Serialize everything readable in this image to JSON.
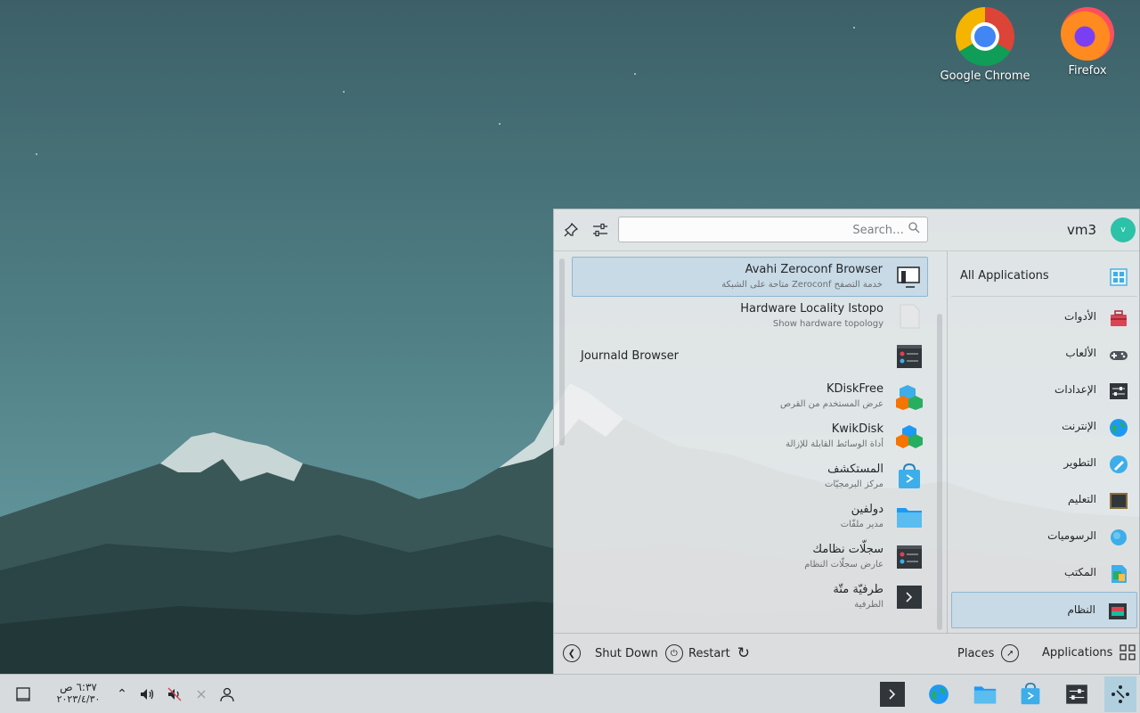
{
  "desktop": {
    "icons": [
      {
        "label": "Google Chrome",
        "icon": "chrome-icon"
      },
      {
        "label": "Firefox",
        "icon": "firefox-icon"
      }
    ]
  },
  "launcher": {
    "search_placeholder": "Search…",
    "user_name": "vm3",
    "avatar_letter": "v",
    "apps": [
      {
        "name": "Avahi Zeroconf Browser",
        "desc": "خدمة التصفح Zeroconf متاحة على الشبكة",
        "icon": "monitor-network-icon",
        "selected": true
      },
      {
        "name": "Hardware Locality lstopo",
        "desc": "Show hardware topology",
        "icon": "blank-file-icon"
      },
      {
        "name": "Journald Browser",
        "desc": "",
        "icon": "system-log-icon"
      },
      {
        "name": "KDiskFree",
        "desc": "عرض المستخدم من القرص",
        "icon": "kdiskfree-icon"
      },
      {
        "name": "KwikDisk",
        "desc": "أداة الوسائط القابلة للإزالة",
        "icon": "kwikdisk-icon"
      },
      {
        "name": "المستكشف",
        "desc": "مركز البرمجيّات",
        "icon": "discover-icon"
      },
      {
        "name": "دولفين",
        "desc": "مدير ملفّات",
        "icon": "folder-icon"
      },
      {
        "name": "سجلّات نظامك",
        "desc": "عارض سجلّات النظام",
        "icon": "system-log-icon"
      },
      {
        "name": "طرفيّة متّة",
        "desc": "الطرفية",
        "icon": "terminal-icon"
      }
    ],
    "categories": [
      {
        "label": "All Applications",
        "icon": "grid-apps-icon"
      },
      {
        "label": "الأدوات",
        "icon": "toolbox-icon"
      },
      {
        "label": "الألعاب",
        "icon": "gamepad-icon"
      },
      {
        "label": "الإعدادات",
        "icon": "settings-icon"
      },
      {
        "label": "الإنترنت",
        "icon": "globe-icon"
      },
      {
        "label": "التطوير",
        "icon": "development-icon"
      },
      {
        "label": "التعليم",
        "icon": "education-icon"
      },
      {
        "label": "الرسوميات",
        "icon": "graphics-icon"
      },
      {
        "label": "المكتب",
        "icon": "office-icon"
      },
      {
        "label": "النظام",
        "icon": "system-icon",
        "active": true
      }
    ],
    "footer": {
      "shutdown": "Shut Down",
      "restart": "Restart",
      "places": "Places",
      "applications": "Applications"
    }
  },
  "taskbar": {
    "time": "٦:٣٧ ص",
    "date": "٢٠٢٣/٤/٣٠"
  },
  "colors": {
    "accent": "#3daee9",
    "selection_bg": "#c7dae6",
    "avatar": "#2bc2a8"
  }
}
